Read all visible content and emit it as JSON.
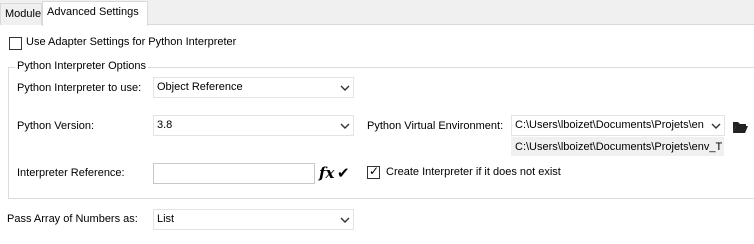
{
  "tabs": [
    {
      "label": "Module",
      "active": false
    },
    {
      "label": "Advanced Settings",
      "active": true
    }
  ],
  "use_adapter": {
    "label": "Use Adapter Settings for Python Interpreter",
    "checked": false
  },
  "group": {
    "title": "Python Interpreter Options"
  },
  "interpreter": {
    "label": "Python Interpreter to use:",
    "value": "Object Reference"
  },
  "version": {
    "label": "Python Version:",
    "value": "3.8"
  },
  "venv": {
    "label": "Python Virtual Environment:",
    "selected": "C:\\Users\\lboizet\\Documents\\Projets\\en",
    "path": "C:\\Users\\lboizet\\Documents\\Projets\\env_T"
  },
  "reference": {
    "label": "Interpreter Reference:",
    "value": "",
    "fx": "fx",
    "check": "✔"
  },
  "create_interpreter": {
    "label": "Create Interpreter if it does not exist",
    "checked": true
  },
  "pass_array": {
    "label": "Pass Array of Numbers as:",
    "value": "List"
  },
  "icons": {
    "dropdown": "chevron-down-icon",
    "browse": "folder-icon",
    "confirm": "checkmark-icon"
  },
  "colors": {
    "border": "#dcdcdc",
    "tab_bg": "#f0f0f0",
    "readonly_bg": "#f0f0f0"
  }
}
